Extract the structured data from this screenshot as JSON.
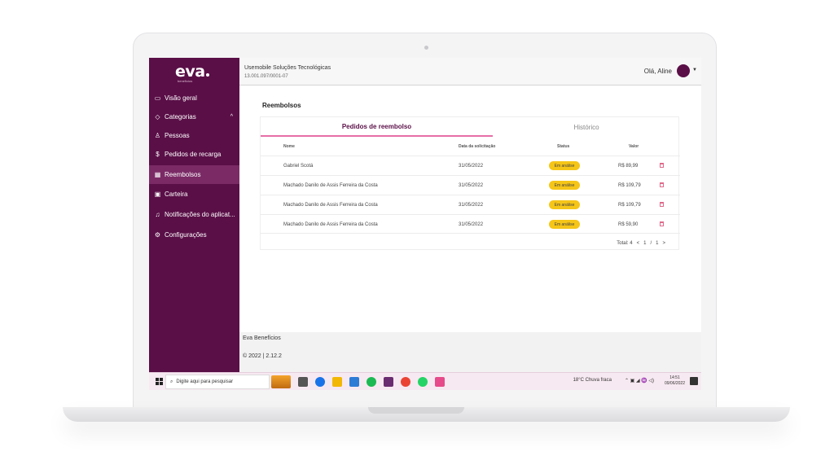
{
  "sidebar": {
    "logo": "eva",
    "logo_sub": "benefícios",
    "items": [
      {
        "label": "Visão geral",
        "icon": "monitor-icon"
      },
      {
        "label": "Categorias",
        "icon": "tag-icon"
      },
      {
        "label": "Pessoas",
        "icon": "person-icon"
      },
      {
        "label": "Pedidos de recarga",
        "icon": "dollar-icon"
      },
      {
        "label": "Reembolsos",
        "icon": "receipt-icon"
      },
      {
        "label": "Carteira",
        "icon": "wallet-icon"
      },
      {
        "label": "Notificações do aplicat...",
        "icon": "bell-icon"
      },
      {
        "label": "Configurações",
        "icon": "gear-icon"
      }
    ]
  },
  "header": {
    "company": "Usemobile Soluções Tecnológicas",
    "cnpj": "13.001.097/0001-07",
    "greeting": "Olá, Aline"
  },
  "page": {
    "title": "Reembolsos",
    "tabs": [
      "Pedidos de reembolso",
      "Histórico"
    ],
    "columns": [
      "Nome",
      "Data da solicitação",
      "Status",
      "Valor"
    ],
    "rows": [
      {
        "name": "Gabriel Scotá",
        "date": "31/05/2022",
        "status": "Em análise",
        "value": "R$ 89,99"
      },
      {
        "name": "Machado Danilo de Assis Ferreira da Costa",
        "date": "31/05/2022",
        "status": "Em análise",
        "value": "R$ 109,79"
      },
      {
        "name": "Machado Danilo de Assis Ferreira da Costa",
        "date": "31/05/2022",
        "status": "Em análise",
        "value": "R$ 109,79"
      },
      {
        "name": "Machado Danilo de Assis Ferreira da Costa",
        "date": "31/05/2022",
        "status": "Em análise",
        "value": "R$ 59,90"
      }
    ],
    "pagination": {
      "total": "Total: 4",
      "current": "1",
      "separator": "/",
      "pages": "1"
    }
  },
  "footer": {
    "brand": "Eva Benefícios",
    "version": "© 2022 | 2.12.2"
  },
  "taskbar": {
    "search_placeholder": "Digite aqui para pesquisar",
    "weather": "18°C Chuva fraca",
    "time": "14:51",
    "date": "09/06/2022"
  },
  "colors": {
    "sidebar": "#5a0f47",
    "accent": "#e76fa7",
    "badge": "#f5c518"
  }
}
